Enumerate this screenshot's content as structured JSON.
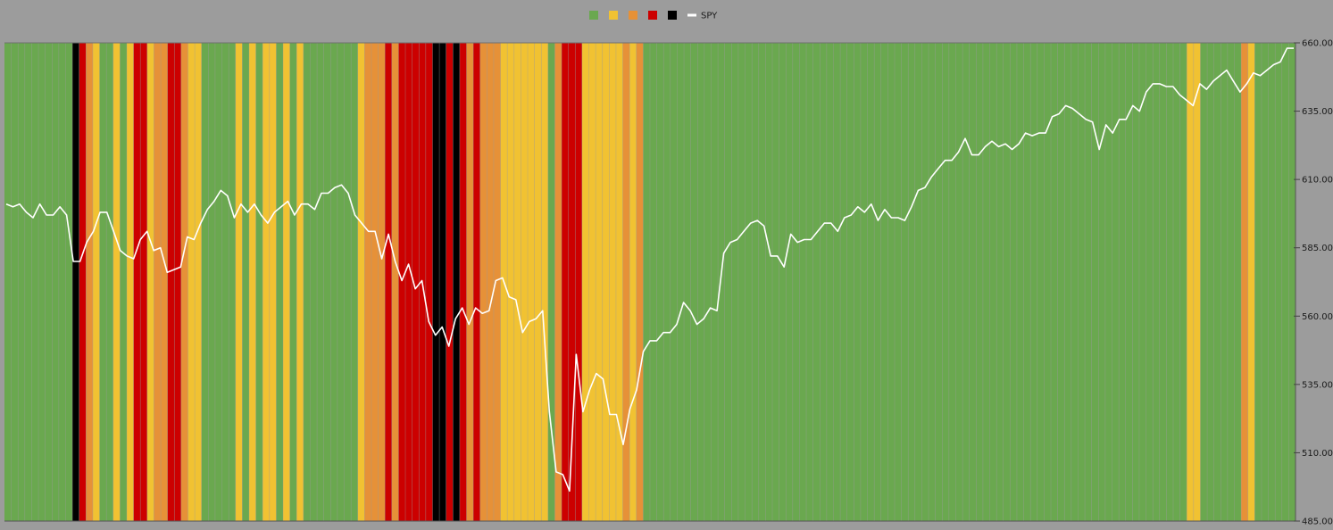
{
  "chart_data": {
    "type": "bar",
    "title": "",
    "xlabel": "",
    "ylabel": "",
    "ylim": [
      485,
      660
    ],
    "y_ticks": [
      "485.00",
      "510.00",
      "535.00",
      "560.00",
      "585.00",
      "610.00",
      "635.00",
      "660.00"
    ],
    "y_tick_values": [
      485,
      510,
      535,
      560,
      585,
      610,
      635,
      660
    ],
    "y_axis_side": "right",
    "grid": true,
    "legend_placement": "top-center",
    "period_count": 190,
    "legend": [
      {
        "key": "green",
        "color": "#6aa84f",
        "label": ""
      },
      {
        "key": "yellow",
        "color": "#f1c232",
        "label": ""
      },
      {
        "key": "orange",
        "color": "#e69138",
        "label": ""
      },
      {
        "key": "red",
        "color": "#cc0000",
        "label": ""
      },
      {
        "key": "black",
        "color": "#000000",
        "label": ""
      },
      {
        "key": "spy",
        "color": "#ffffff",
        "label": "SPY",
        "type": "line"
      }
    ],
    "regimes": [
      {
        "from": 0,
        "to": 10,
        "color": "green"
      },
      {
        "from": 10,
        "to": 11,
        "color": "black"
      },
      {
        "from": 11,
        "to": 12,
        "color": "red"
      },
      {
        "from": 12,
        "to": 13,
        "color": "orange"
      },
      {
        "from": 13,
        "to": 14,
        "color": "yellow"
      },
      {
        "from": 14,
        "to": 16,
        "color": "green"
      },
      {
        "from": 16,
        "to": 17,
        "color": "yellow"
      },
      {
        "from": 17,
        "to": 18,
        "color": "green"
      },
      {
        "from": 18,
        "to": 19,
        "color": "yellow"
      },
      {
        "from": 19,
        "to": 21,
        "color": "red"
      },
      {
        "from": 21,
        "to": 22,
        "color": "yellow"
      },
      {
        "from": 22,
        "to": 24,
        "color": "orange"
      },
      {
        "from": 24,
        "to": 26,
        "color": "red"
      },
      {
        "from": 26,
        "to": 27,
        "color": "orange"
      },
      {
        "from": 27,
        "to": 29,
        "color": "yellow"
      },
      {
        "from": 29,
        "to": 34,
        "color": "green"
      },
      {
        "from": 34,
        "to": 35,
        "color": "yellow"
      },
      {
        "from": 35,
        "to": 36,
        "color": "green"
      },
      {
        "from": 36,
        "to": 37,
        "color": "yellow"
      },
      {
        "from": 37,
        "to": 38,
        "color": "green"
      },
      {
        "from": 38,
        "to": 40,
        "color": "yellow"
      },
      {
        "from": 40,
        "to": 41,
        "color": "green"
      },
      {
        "from": 41,
        "to": 42,
        "color": "yellow"
      },
      {
        "from": 42,
        "to": 43,
        "color": "green"
      },
      {
        "from": 43,
        "to": 44,
        "color": "yellow"
      },
      {
        "from": 44,
        "to": 52,
        "color": "green"
      },
      {
        "from": 52,
        "to": 53,
        "color": "yellow"
      },
      {
        "from": 53,
        "to": 56,
        "color": "orange"
      },
      {
        "from": 56,
        "to": 57,
        "color": "red"
      },
      {
        "from": 57,
        "to": 58,
        "color": "orange"
      },
      {
        "from": 58,
        "to": 63,
        "color": "red"
      },
      {
        "from": 63,
        "to": 65,
        "color": "black"
      },
      {
        "from": 65,
        "to": 66,
        "color": "red"
      },
      {
        "from": 66,
        "to": 67,
        "color": "black"
      },
      {
        "from": 67,
        "to": 68,
        "color": "red"
      },
      {
        "from": 68,
        "to": 69,
        "color": "orange"
      },
      {
        "from": 69,
        "to": 70,
        "color": "red"
      },
      {
        "from": 70,
        "to": 73,
        "color": "orange"
      },
      {
        "from": 73,
        "to": 80,
        "color": "yellow"
      },
      {
        "from": 80,
        "to": 81,
        "color": "green"
      },
      {
        "from": 81,
        "to": 82,
        "color": "orange"
      },
      {
        "from": 82,
        "to": 85,
        "color": "red"
      },
      {
        "from": 85,
        "to": 91,
        "color": "yellow"
      },
      {
        "from": 91,
        "to": 92,
        "color": "orange"
      },
      {
        "from": 92,
        "to": 93,
        "color": "yellow"
      },
      {
        "from": 93,
        "to": 94,
        "color": "orange"
      },
      {
        "from": 94,
        "to": 174,
        "color": "green"
      },
      {
        "from": 174,
        "to": 176,
        "color": "yellow"
      },
      {
        "from": 176,
        "to": 182,
        "color": "green"
      },
      {
        "from": 182,
        "to": 183,
        "color": "orange"
      },
      {
        "from": 183,
        "to": 184,
        "color": "yellow"
      },
      {
        "from": 184,
        "to": 190,
        "color": "green"
      }
    ],
    "series": [
      {
        "name": "SPY",
        "values": [
          601,
          600,
          601,
          598,
          596,
          601,
          597,
          597,
          600,
          597,
          580,
          580,
          587,
          591,
          598,
          598,
          591,
          584,
          582,
          581,
          588,
          591,
          584,
          585,
          576,
          577,
          578,
          589,
          588,
          594,
          599,
          602,
          606,
          604,
          596,
          601,
          598,
          601,
          597,
          594,
          598,
          600,
          602,
          597,
          601,
          601,
          599,
          605,
          605,
          607,
          608,
          605,
          597,
          594,
          591,
          591,
          581,
          590,
          580,
          573,
          579,
          570,
          573,
          558,
          553,
          556,
          549,
          559,
          563,
          557,
          563,
          561,
          562,
          573,
          574,
          567,
          566,
          554,
          558,
          559,
          562,
          525,
          503,
          502,
          496,
          546,
          525,
          533,
          539,
          537,
          524,
          524,
          513,
          526,
          533,
          547,
          551,
          551,
          554,
          554,
          557,
          565,
          562,
          557,
          559,
          563,
          562,
          583,
          587,
          588,
          591,
          594,
          595,
          593,
          582,
          582,
          578,
          590,
          587,
          588,
          588,
          591,
          594,
          594,
          591,
          596,
          597,
          600,
          598,
          601,
          595,
          599,
          596,
          596,
          595,
          600,
          606,
          607,
          611,
          614,
          617,
          617,
          620,
          625,
          619,
          619,
          622,
          624,
          622,
          623,
          621,
          623,
          627,
          626,
          627,
          627,
          633,
          634,
          637,
          636,
          634,
          632,
          631,
          621,
          630,
          627,
          632,
          632,
          637,
          635,
          642,
          645,
          645,
          644,
          644,
          641,
          639,
          637,
          645,
          643,
          646,
          648,
          650,
          646,
          642,
          645,
          649,
          648,
          650,
          652,
          653,
          658,
          658
        ]
      }
    ]
  }
}
